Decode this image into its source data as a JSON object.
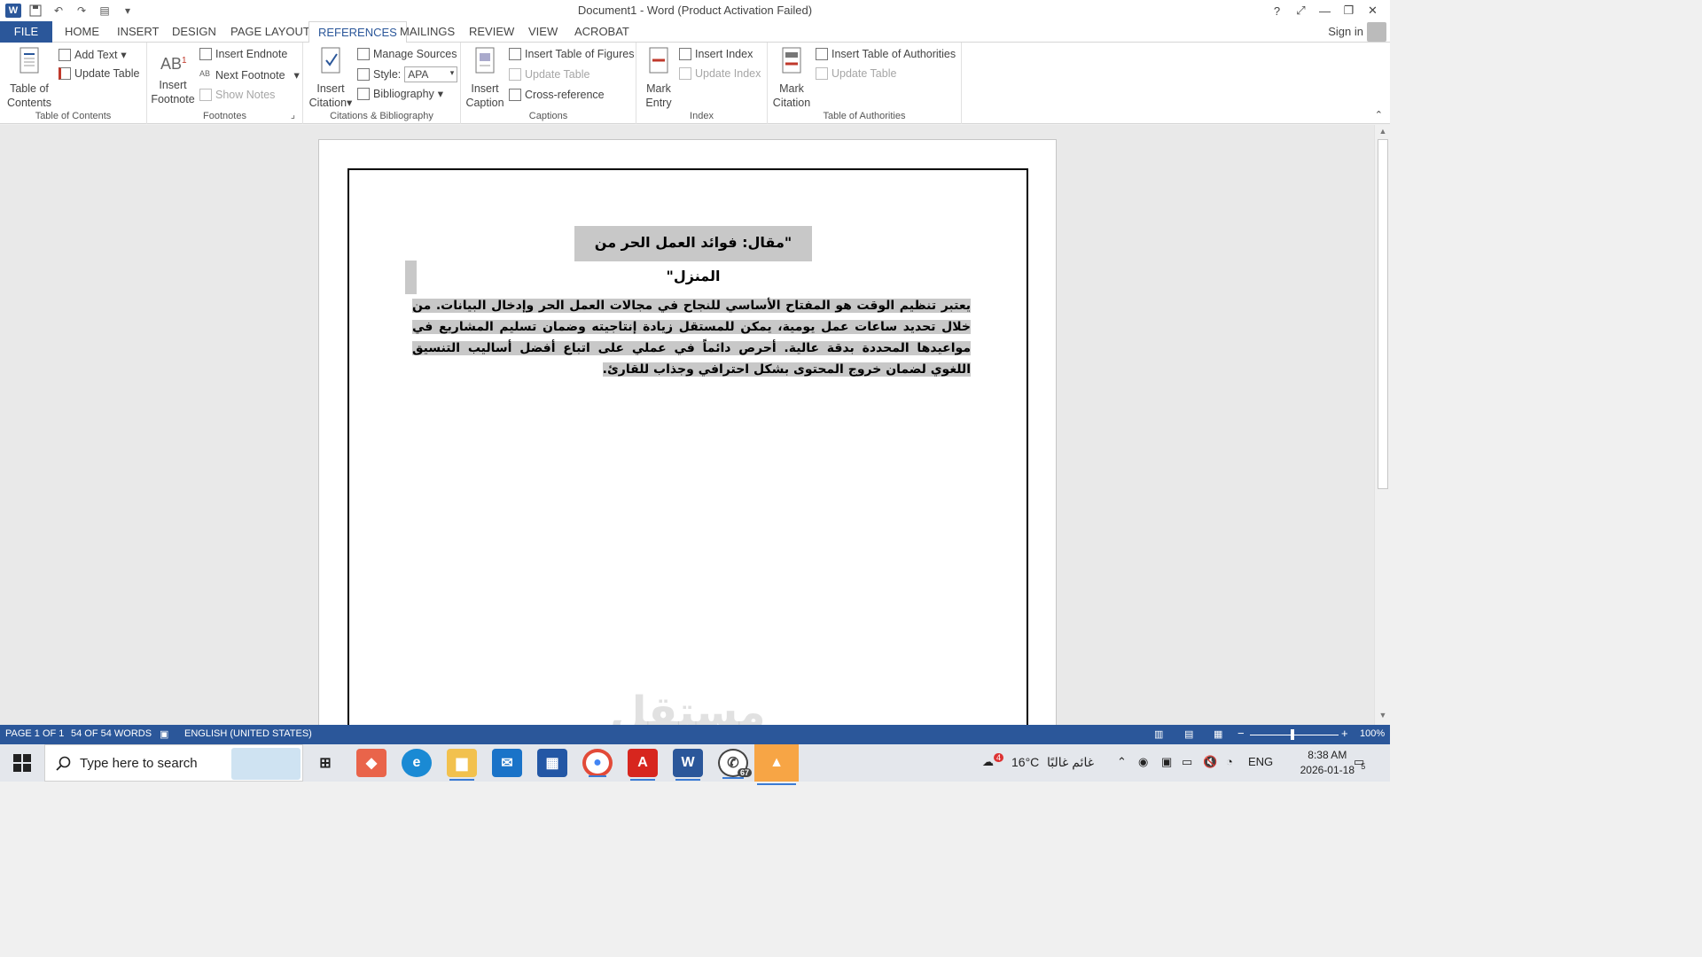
{
  "titlebar": {
    "title": "Document1 - Word (Product Activation Failed)",
    "help": "?",
    "controls": [
      "⤢",
      "—",
      "❐",
      "✕"
    ]
  },
  "tabs": {
    "file": "FILE",
    "items": [
      "HOME",
      "INSERT",
      "DESIGN",
      "PAGE LAYOUT",
      "REFERENCES",
      "MAILINGS",
      "REVIEW",
      "VIEW",
      "ACROBAT"
    ],
    "active": "REFERENCES",
    "sign_in": "Sign in"
  },
  "ribbon": {
    "toc": {
      "label": "Table of",
      "label2": "Contents",
      "add_text": "Add Text",
      "update_table": "Update Table",
      "group": "Table of Contents"
    },
    "footnotes": {
      "insert_footnote": "Insert",
      "insert_footnote2": "Footnote",
      "insert_endnote": "Insert Endnote",
      "next_footnote": "Next Footnote",
      "show_notes": "Show Notes",
      "group": "Footnotes"
    },
    "citations": {
      "insert_citation": "Insert",
      "insert_citation2": "Citation",
      "manage_sources": "Manage Sources",
      "style_label": "Style:",
      "style_value": "APA",
      "bibliography": "Bibliography",
      "group": "Citations & Bibliography"
    },
    "captions": {
      "insert_caption": "Insert",
      "insert_caption2": "Caption",
      "insert_table_figures": "Insert Table of Figures",
      "update_table": "Update Table",
      "cross_reference": "Cross-reference",
      "group": "Captions"
    },
    "index": {
      "mark_entry": "Mark",
      "mark_entry2": "Entry",
      "insert_index": "Insert Index",
      "update_index": "Update Index",
      "group": "Index"
    },
    "authorities": {
      "mark_citation": "Mark",
      "mark_citation2": "Citation",
      "insert_toa": "Insert Table of Authorities",
      "update_table": "Update Table",
      "group": "Table of Authorities"
    }
  },
  "document": {
    "heading": "\"مقال: فوائد العمل الحر من المنزل\"",
    "paragraph": "يعتبر تنظيم الوقت هو المفتاح الأساسي للنجاح في مجالات العمل الحر وإدخال البيانات. من خلال تحديد ساعات عمل يومية، يمكن للمستقل زيادة إنتاجيته وضمان تسليم المشاريع في مواعيدها المحددة بدقة عالية. أحرص دائماً في عملي على اتباع أفضل أساليب التنسيق اللغوي لضمان خروج المحتوى بشكل احترافي وجذاب للقارئ."
  },
  "statusbar": {
    "page": "PAGE 1 OF 1",
    "words": "54 OF 54 WORDS",
    "language": "ENGLISH (UNITED STATES)",
    "zoom": "100%",
    "zoom_minus": "−",
    "zoom_plus": "+"
  },
  "taskbar": {
    "search_placeholder": "Type here to search",
    "whatsapp_badge": "67",
    "weather_temp": "16°C",
    "weather_text": "غائم غالبًا",
    "weather_badge": "4",
    "language": "ENG",
    "time": "8:38 AM",
    "date": "2026-01-18",
    "notif_count": "5"
  },
  "watermark": "مستقل",
  "colors": {
    "accent": "#2b579a",
    "highlight": "#c8c8c8"
  }
}
